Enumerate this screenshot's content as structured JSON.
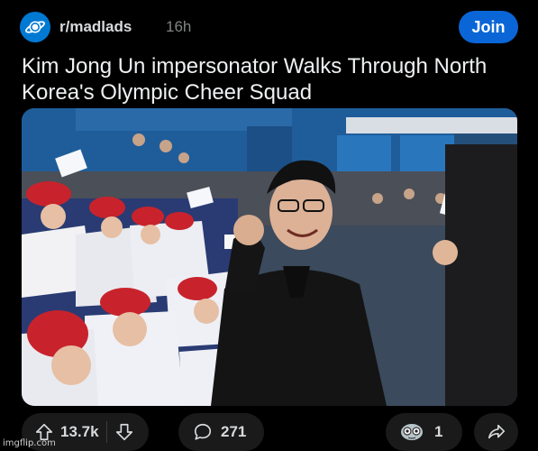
{
  "post": {
    "subreddit": "r/madlads",
    "time_ago": "16h",
    "join_label": "Join",
    "title": "Kim Jong Un impersonator Walks Through North Korea's Olympic Cheer Squad"
  },
  "actions": {
    "upvotes": "13.7k",
    "comments": "271",
    "awards": "1"
  },
  "icons": {
    "subreddit_avatar": "planet-icon",
    "upvote": "arrow-up-icon",
    "downvote": "arrow-down-icon",
    "comment": "speech-bubble-icon",
    "award": "award-icon",
    "share": "share-icon"
  },
  "colors": {
    "background": "#000000",
    "join_button": "#0a66d6",
    "pill": "#1a1a1b",
    "muted_text": "#818384"
  },
  "watermark": "imgflip.com"
}
